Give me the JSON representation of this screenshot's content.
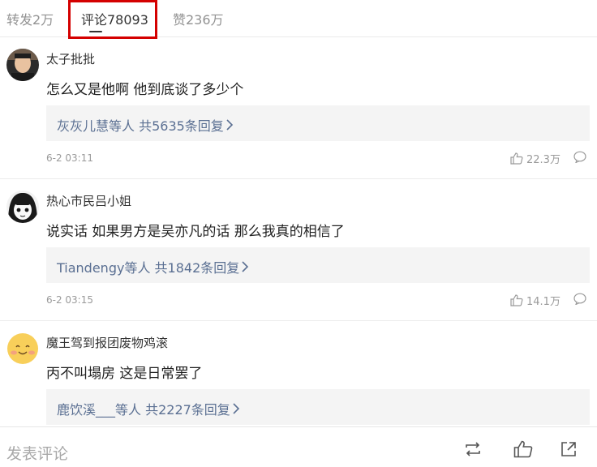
{
  "tabs": [
    {
      "label": "转发2万"
    },
    {
      "label": "评论78093"
    },
    {
      "label": "赞236万"
    }
  ],
  "comments": [
    {
      "username": "太子批批",
      "content": "怎么又是他啊 他到底谈了多少个",
      "reply": "灰灰儿慧等人 共5635条回复",
      "time": "6-2 03:11",
      "likes": "22.3万"
    },
    {
      "username": "热心市民吕小姐",
      "content": "说实话 如果男方是吴亦凡的话 那么我真的相信了",
      "reply": "Tiandengy等人 共1842条回复",
      "time": "6-2 03:15",
      "likes": "14.1万"
    },
    {
      "username": "魔王驾到报团废物鸡滚",
      "content": "丙不叫塌房 这是日常罢了",
      "reply": "鹿饮溪___等人 共2227条回复"
    }
  ],
  "bottom": {
    "comment_placeholder": "发表评论"
  },
  "colors": {
    "highlight": "#d40000",
    "reply_link": "#5a6f92"
  }
}
